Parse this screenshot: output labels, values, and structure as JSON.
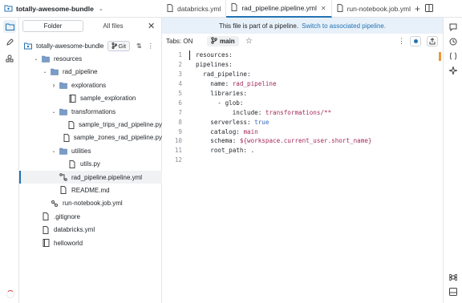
{
  "bundle": {
    "name": "totally-awesome-bundle"
  },
  "tabs": [
    {
      "label": "databricks.yml",
      "active": false
    },
    {
      "label": "rad_pipeline.pipeline.yml",
      "active": true
    },
    {
      "label": "run-notebook.job.yml",
      "active": false
    }
  ],
  "panel": {
    "tab_folder": "Folder",
    "tab_all_files": "All files",
    "git_badge": "Git"
  },
  "tree": [
    {
      "label": "totally-awesome-bundle",
      "depth": 0,
      "type": "bundle",
      "caret": ""
    },
    {
      "label": "resources",
      "depth": 1,
      "type": "folder",
      "caret": "v"
    },
    {
      "label": "rad_pipeline",
      "depth": 2,
      "type": "folder",
      "caret": "v"
    },
    {
      "label": "explorations",
      "depth": 3,
      "type": "folder",
      "caret": ">"
    },
    {
      "label": "sample_exploration",
      "depth": 4,
      "type": "notebook",
      "caret": ""
    },
    {
      "label": "transformations",
      "depth": 3,
      "type": "folder",
      "caret": "v"
    },
    {
      "label": "sample_trips_rad_pipeline.py",
      "depth": 4,
      "type": "file",
      "caret": ""
    },
    {
      "label": "sample_zones_rad_pipeline.py",
      "depth": 4,
      "type": "file",
      "caret": ""
    },
    {
      "label": "utilities",
      "depth": 3,
      "type": "folder",
      "caret": "v"
    },
    {
      "label": "utils.py",
      "depth": 4,
      "type": "file",
      "caret": ""
    },
    {
      "label": "rad_pipeline.pipeline.yml",
      "depth": 3,
      "type": "pipeline",
      "caret": "",
      "selected": true
    },
    {
      "label": "README.md",
      "depth": 3,
      "type": "file",
      "caret": ""
    },
    {
      "label": "run-notebook.job.yml",
      "depth": 2,
      "type": "job",
      "caret": ""
    },
    {
      "label": ".gitignore",
      "depth": 1,
      "type": "file",
      "caret": ""
    },
    {
      "label": "databricks.yml",
      "depth": 1,
      "type": "file",
      "caret": ""
    },
    {
      "label": "helloworld",
      "depth": 1,
      "type": "notebook",
      "caret": ""
    }
  ],
  "banner": {
    "text": "This file is part of a pipeline.",
    "link": "Switch to associated pipeline."
  },
  "toolbar": {
    "tabs_on": "Tabs: ON",
    "branch": "main"
  },
  "code_lines": [
    [
      {
        "t": "resources:",
        "c": "k"
      }
    ],
    [
      {
        "t": "pipelines:",
        "c": "k"
      }
    ],
    [
      {
        "t": "  rad_pipeline:",
        "c": "k"
      }
    ],
    [
      {
        "t": "    name: ",
        "c": "k"
      },
      {
        "t": "rad_pipeline",
        "c": "s"
      }
    ],
    [
      {
        "t": "    libraries:",
        "c": "k"
      }
    ],
    [
      {
        "t": "      - glob:",
        "c": "k"
      }
    ],
    [
      {
        "t": "          include: ",
        "c": "k"
      },
      {
        "t": "transformations/**",
        "c": "s"
      }
    ],
    [
      {
        "t": "    serverless: ",
        "c": "k"
      },
      {
        "t": "true",
        "c": "b"
      }
    ],
    [
      {
        "t": "    catalog: ",
        "c": "k"
      },
      {
        "t": "main",
        "c": "s"
      }
    ],
    [
      {
        "t": "    schema: ",
        "c": "k"
      },
      {
        "t": "${workspace.current_user.short_name}",
        "c": "s"
      }
    ],
    [
      {
        "t": "    root_path: .",
        "c": "k"
      }
    ],
    []
  ],
  "colors": {
    "accent": "#2272b4",
    "string": "#a3295a",
    "bool": "#3a69c6"
  }
}
